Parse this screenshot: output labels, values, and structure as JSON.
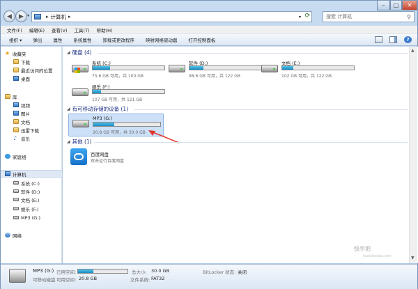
{
  "window": {
    "breadcrumb": [
      "计算机"
    ],
    "search_placeholder": "搜索 计算机"
  },
  "menubar": [
    "文件(F)",
    "编辑(E)",
    "查看(V)",
    "工具(T)",
    "帮助(H)"
  ],
  "toolbar": {
    "organize": "组织 ▾",
    "items": [
      "弹出",
      "属性",
      "系统属性",
      "卸载或更改程序",
      "映射网络驱动器",
      "打开控制面板"
    ]
  },
  "navpane": {
    "favorites": {
      "label": "收藏夹",
      "items": [
        "下载",
        "最近访问的位置",
        "桌面"
      ]
    },
    "libraries": {
      "label": "库",
      "items": [
        "视频",
        "图片",
        "文档",
        "迅雷下载",
        "音乐"
      ]
    },
    "homegroup": "家庭组",
    "computer": {
      "label": "计算机",
      "items": [
        "系统 (C:)",
        "软件 (D:)",
        "文档 (E:)",
        "娱乐 (F:)",
        "MP3 (G:)"
      ]
    },
    "network": "网络"
  },
  "groups": {
    "hdd": {
      "header": "硬盘 (4)",
      "drives": [
        {
          "name": "系统 (C:)",
          "info": "75.6 GB 可用，共 100 GB",
          "used_fraction": 0.24
        },
        {
          "name": "软件 (D:)",
          "info": "98.6 GB 可用，共 122 GB",
          "used_fraction": 0.19
        },
        {
          "name": "文档 (E:)",
          "info": "102 GB 可用，共 122 GB",
          "used_fraction": 0.16
        },
        {
          "name": "娱乐 (F:)",
          "info": "107 GB 可用，共 121 GB",
          "used_fraction": 0.12
        }
      ]
    },
    "removable": {
      "header": "有可移动存储的设备 (1)",
      "drives": [
        {
          "name": "MP3 (G:)",
          "info": "20.8 GB 可用，共 30.0 GB",
          "used_fraction": 0.31
        }
      ]
    },
    "other": {
      "header": "其他 (1)",
      "items": [
        {
          "name": "百度网盘",
          "desc": "双击运行百度网盘"
        }
      ]
    }
  },
  "statusbar": {
    "drive_name": "MP3 (G:)",
    "drive_type": "可移动磁盘",
    "used_label": "已用空间:",
    "free_label": "可用空间:",
    "free_value": "20.8 GB",
    "total_label": "总大小:",
    "total_value": "30.0 GB",
    "fs_label": "文件系统:",
    "fs_value": "FAT32",
    "bitlocker_label": "BitLocker 状态:",
    "bitlocker_value": "关闭",
    "used_fraction": 0.31
  },
  "watermark": {
    "main": "快手把",
    "sub": "kuaishouba.com"
  }
}
